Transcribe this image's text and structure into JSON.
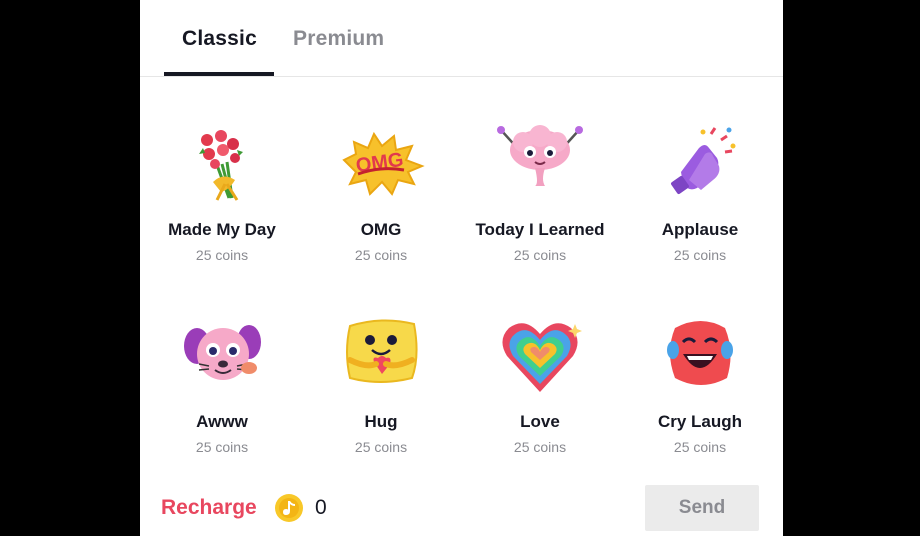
{
  "tabs": [
    {
      "label": "Classic",
      "active": true
    },
    {
      "label": "Premium",
      "active": false
    }
  ],
  "gifts": [
    {
      "name": "Made My Day",
      "price": "25 coins",
      "icon": "flower-bouquet-icon"
    },
    {
      "name": "OMG",
      "price": "25 coins",
      "icon": "omg-splash-icon"
    },
    {
      "name": "Today I Learned",
      "price": "25 coins",
      "icon": "brain-icon"
    },
    {
      "name": "Applause",
      "price": "25 coins",
      "icon": "clapping-hands-icon"
    },
    {
      "name": "Awww",
      "price": "25 coins",
      "icon": "puppy-icon"
    },
    {
      "name": "Hug",
      "price": "25 coins",
      "icon": "hug-sponge-icon"
    },
    {
      "name": "Love",
      "price": "25 coins",
      "icon": "rainbow-heart-icon"
    },
    {
      "name": "Cry Laugh",
      "price": "25 coins",
      "icon": "cry-laugh-face-icon"
    }
  ],
  "footer": {
    "recharge_label": "Recharge",
    "coin_balance": "0",
    "send_label": "Send"
  },
  "colors": {
    "accent": "#e8475f",
    "text": "#161823",
    "muted": "#8a8b91",
    "coin": "#f8c829"
  }
}
